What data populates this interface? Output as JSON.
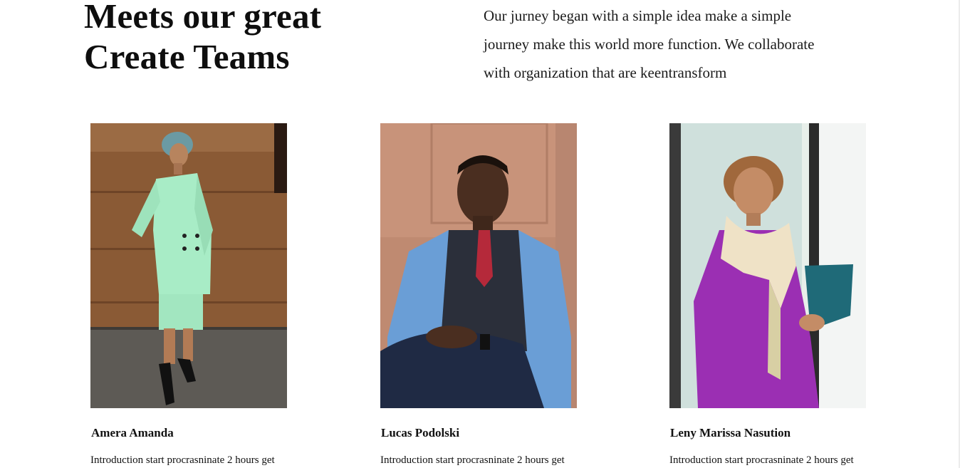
{
  "section": {
    "heading": [
      "Meets our great",
      "Create Teams"
    ],
    "intro": [
      "Our jurney began with a simple idea make a simple",
      "journey make this world more function. We collaborate",
      "with organization that are keentransform"
    ]
  },
  "team": [
    {
      "name": "Amera Amanda",
      "description": "Introduction start procrasninate 2 hours get"
    },
    {
      "name": "Lucas Podolski",
      "description": "Introduction start procrasninate 2 hours get"
    },
    {
      "name": "Leny Marissa Nasution",
      "description": "Introduction start procrasninate 2 hours get"
    }
  ]
}
